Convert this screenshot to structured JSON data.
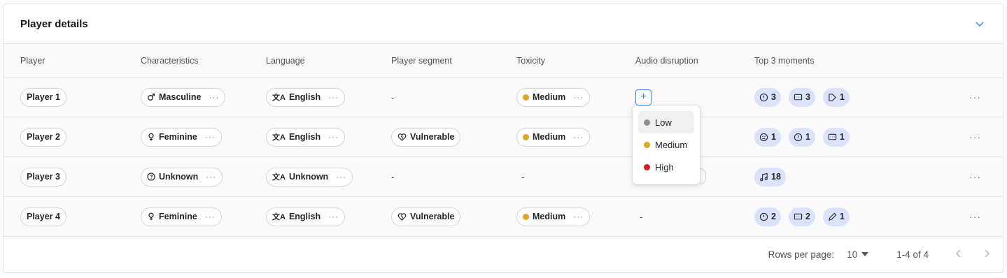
{
  "card": {
    "title": "Player details"
  },
  "columns": [
    "Player",
    "Characteristics",
    "Language",
    "Player segment",
    "Toxicity",
    "Audio disruption",
    "Top 3 moments"
  ],
  "rows": [
    {
      "player": "Player 1",
      "characteristic": {
        "icon": "masculine-icon",
        "label": "Masculine"
      },
      "language": "English",
      "segment": null,
      "segment_text": "-",
      "toxicity": {
        "label": "Medium",
        "color": "#e0a526"
      },
      "audio": "add",
      "moments": [
        {
          "icon": "alert-icon",
          "count": "3"
        },
        {
          "icon": "chat-icon",
          "count": "3"
        },
        {
          "icon": "voice-icon",
          "count": "1"
        }
      ]
    },
    {
      "player": "Player 2",
      "characteristic": {
        "icon": "feminine-icon",
        "label": "Feminine"
      },
      "language": "English",
      "segment": "Vulnerable",
      "toxicity": {
        "label": "Medium",
        "color": "#e0a526"
      },
      "moments": [
        {
          "icon": "angry-icon",
          "count": "1"
        },
        {
          "icon": "alert-icon",
          "count": "1"
        },
        {
          "icon": "chat-icon",
          "count": "1"
        }
      ]
    },
    {
      "player": "Player 3",
      "characteristic": {
        "icon": "unknown-icon",
        "label": "Unknown"
      },
      "language": "Unknown",
      "segment": null,
      "segment_text": "-",
      "toxicity": null,
      "toxicity_text": "-",
      "moments": [
        {
          "icon": "music-icon",
          "count": "18"
        }
      ]
    },
    {
      "player": "Player 4",
      "characteristic": {
        "icon": "feminine-icon",
        "label": "Feminine"
      },
      "language": "English",
      "segment": "Vulnerable",
      "toxicity": {
        "label": "Medium",
        "color": "#e0a526"
      },
      "audio_text": "-",
      "moments": [
        {
          "icon": "alert-icon",
          "count": "2"
        },
        {
          "icon": "chat-icon",
          "count": "2"
        },
        {
          "icon": "pen-icon",
          "count": "1"
        }
      ]
    }
  ],
  "dropdown": {
    "options": [
      {
        "label": "Low",
        "color": "#8e8e93"
      },
      {
        "label": "Medium",
        "color": "#e0a526"
      },
      {
        "label": "High",
        "color": "#d42020"
      }
    ],
    "highlighted": "Low"
  },
  "footer": {
    "rows_per_page_label": "Rows per page:",
    "rows_per_page_value": "10",
    "range": "1-4 of 4"
  },
  "colors": {
    "accent": "#3b82f6",
    "moment_bg": "#dbe3fb",
    "border": "#e4e4e7"
  }
}
